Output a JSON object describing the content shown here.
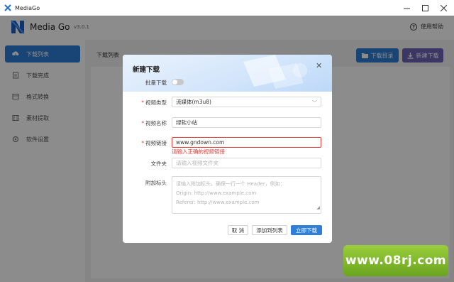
{
  "window": {
    "title": "MediaGo"
  },
  "header": {
    "brand": "Media Go",
    "version": "v3.0.1",
    "help": "使用帮助"
  },
  "sidebar": {
    "items": [
      {
        "label": "下载列表",
        "icon": "cloud-download-icon",
        "active": true
      },
      {
        "label": "下载完成",
        "icon": "document-icon",
        "active": false
      },
      {
        "label": "格式转换",
        "icon": "convert-icon",
        "active": false
      },
      {
        "label": "素材提取",
        "icon": "film-icon",
        "active": false
      },
      {
        "label": "软件设置",
        "icon": "settings-icon",
        "active": false
      }
    ]
  },
  "main": {
    "title": "下载列表",
    "download_dir_button": "下载目录",
    "new_download_button": "新建下载"
  },
  "modal": {
    "title": "新建下载",
    "batch_label": "批量下载",
    "batch_enabled": false,
    "type_label": "视频类型",
    "type_value": "流媒体(m3u8)",
    "name_label": "视频名称",
    "name_value": "绿软小站",
    "url_label": "视频链接",
    "url_value": "www.gndown.com",
    "url_error": "请输入正确的视频链接",
    "folder_label": "文件夹",
    "folder_placeholder": "请输入视频文件夹",
    "headers_label": "附加标头",
    "headers_placeholder": [
      "请输入附加标头，确保一行一个 Header，例如：",
      "Origin: http://www.example.com",
      "Referer: http://www.example.com"
    ],
    "cancel_button": "取 消",
    "add_to_list_button": "添加到列表",
    "download_now_button": "立即下载"
  },
  "watermark": {
    "text": "www.08rj.com"
  },
  "colors": {
    "primary": "#2f7fd8",
    "purple": "#6c63b7",
    "error": "#e0413b",
    "badge_green": "#7bb62a"
  }
}
